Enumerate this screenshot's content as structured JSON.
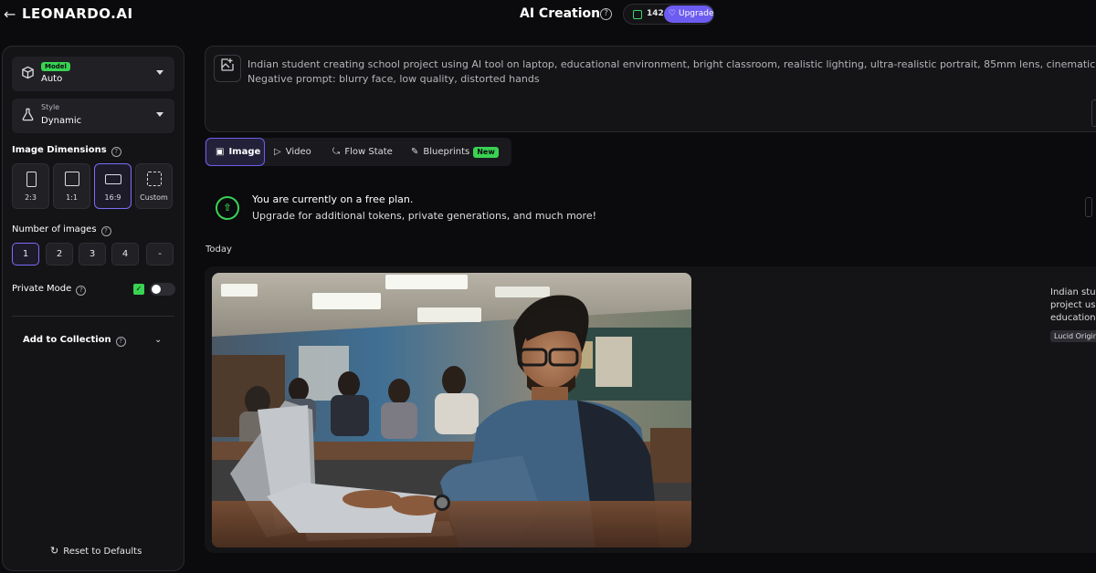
{
  "header": {
    "brand": "LEONARDO.AI",
    "title": "AI Creation",
    "help_icon": "help-circle-icon",
    "token_count": "142",
    "upgrade_label": "Upgrade"
  },
  "sidebar": {
    "model": {
      "caption": "Model",
      "value": "Auto",
      "icon": "cube-icon"
    },
    "style": {
      "caption": "Style",
      "value": "Dynamic",
      "icon": "flask-icon"
    },
    "image_dimensions": {
      "label": "Image Dimensions",
      "options": [
        {
          "label": "2:3",
          "selected": false
        },
        {
          "label": "1:1",
          "selected": false
        },
        {
          "label": "16:9",
          "selected": true
        },
        {
          "label": "Custom",
          "selected": false
        }
      ]
    },
    "number_of_images": {
      "label": "Number of images",
      "options": [
        "1",
        "2",
        "3",
        "4",
        "-"
      ],
      "selected": "1"
    },
    "private_mode": {
      "label": "Private Mode",
      "enabled": false
    },
    "collection_label": "Add to Collection",
    "reset_label": "Reset to Defaults"
  },
  "prompt": {
    "line1": "Indian student creating school project using AI tool on laptop, educational environment, bright classroom, realistic lighting, ultra-realistic portrait, 85mm lens, cinematic style",
    "line2": "Negative prompt: blurry face, low quality, distorted hands"
  },
  "tabs": [
    {
      "label": "Image",
      "icon": "image-icon",
      "active": true
    },
    {
      "label": "Video",
      "icon": "video-icon",
      "active": false
    },
    {
      "label": "Flow State",
      "icon": "flow-icon",
      "active": false
    },
    {
      "label": "Blueprints",
      "icon": "blueprint-icon",
      "active": false,
      "badge": "New"
    }
  ],
  "plan_banner": {
    "line1": "You are currently on a free plan.",
    "line2": "Upgrade for additional tokens, private generations, and much more!"
  },
  "feed": {
    "date_label": "Today",
    "generation": {
      "prompt_excerpt_lines": [
        "Indian stud",
        "project usi",
        "educationa"
      ],
      "model_tag": "Lucid Origin"
    }
  },
  "colors": {
    "accent": "#6d5cf0",
    "success": "#39d353",
    "background": "#0b0b0d",
    "panel": "#141417"
  }
}
